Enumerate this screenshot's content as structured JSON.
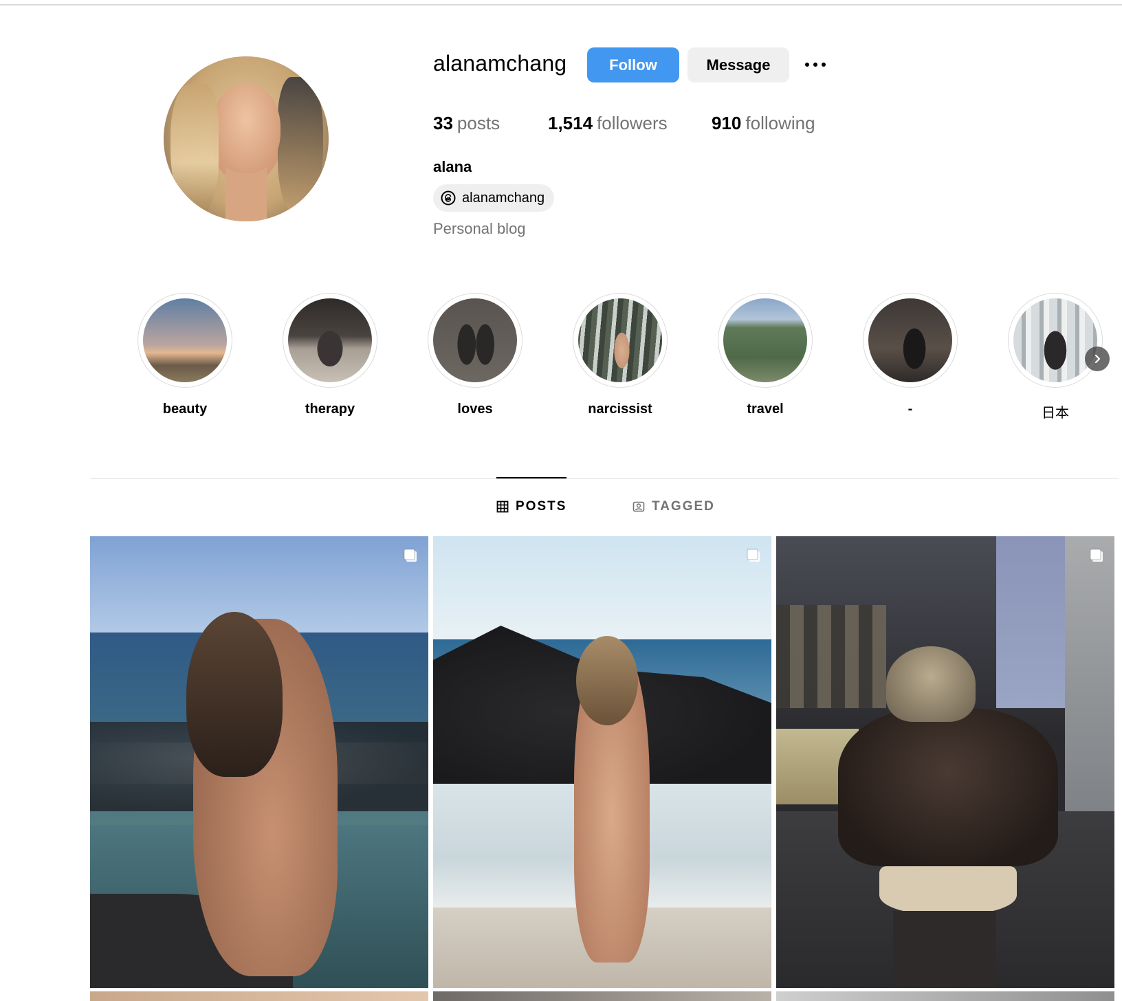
{
  "profile": {
    "username": "alanamchang",
    "follow_label": "Follow",
    "message_label": "Message",
    "more_icon": "more-horizontal-icon",
    "stats": {
      "posts_count": "33",
      "posts_label": "posts",
      "followers_count": "1,514",
      "followers_label": "followers",
      "following_count": "910",
      "following_label": "following"
    },
    "full_name": "alana",
    "threads_handle": "alanamchang",
    "threads_icon": "threads-icon",
    "category": "Personal blog"
  },
  "highlights": [
    {
      "label": "beauty"
    },
    {
      "label": "therapy"
    },
    {
      "label": "loves"
    },
    {
      "label": "narcissist"
    },
    {
      "label": "travel"
    },
    {
      "label": "-"
    },
    {
      "label": "日本"
    }
  ],
  "tabs": {
    "posts_label": "POSTS",
    "tagged_label": "TAGGED"
  },
  "colors": {
    "accent_blue": "#4297f0",
    "secondary_button": "#efefef",
    "muted_text": "#737373",
    "divider": "#dbdbdb"
  }
}
